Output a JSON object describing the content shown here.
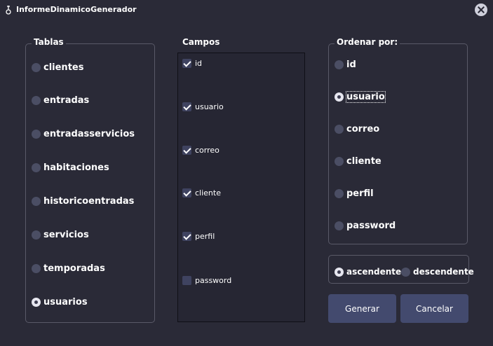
{
  "window": {
    "title": "InformeDinamicoGenerador"
  },
  "tablas": {
    "title": "Tablas",
    "items": [
      {
        "label": "clientes",
        "checked": false
      },
      {
        "label": "entradas",
        "checked": false
      },
      {
        "label": "entradasservicios",
        "checked": false
      },
      {
        "label": "habitaciones",
        "checked": false
      },
      {
        "label": "historicoentradas",
        "checked": false
      },
      {
        "label": "servicios",
        "checked": false
      },
      {
        "label": "temporadas",
        "checked": false
      },
      {
        "label": "usuarios",
        "checked": true
      }
    ]
  },
  "campos": {
    "title": "Campos",
    "items": [
      {
        "label": "id",
        "checked": true
      },
      {
        "label": "usuario",
        "checked": true
      },
      {
        "label": "correo",
        "checked": true
      },
      {
        "label": "cliente",
        "checked": true
      },
      {
        "label": "perfil",
        "checked": true
      },
      {
        "label": "password",
        "checked": false
      }
    ]
  },
  "ordenar": {
    "title": "Ordenar por:",
    "items": [
      {
        "label": "id",
        "checked": false
      },
      {
        "label": "usuario",
        "checked": true
      },
      {
        "label": "correo",
        "checked": false
      },
      {
        "label": "cliente",
        "checked": false
      },
      {
        "label": "perfil",
        "checked": false
      },
      {
        "label": "password",
        "checked": false
      }
    ]
  },
  "direccion": {
    "ascendente": "ascendente",
    "descendente": "descendente",
    "selected": "ascendente"
  },
  "buttons": {
    "generar": "Generar",
    "cancelar": "Cancelar"
  },
  "colors": {
    "background": "#2a2a37",
    "button": "#434a6e",
    "radio_unchecked": "#4b4e64"
  }
}
